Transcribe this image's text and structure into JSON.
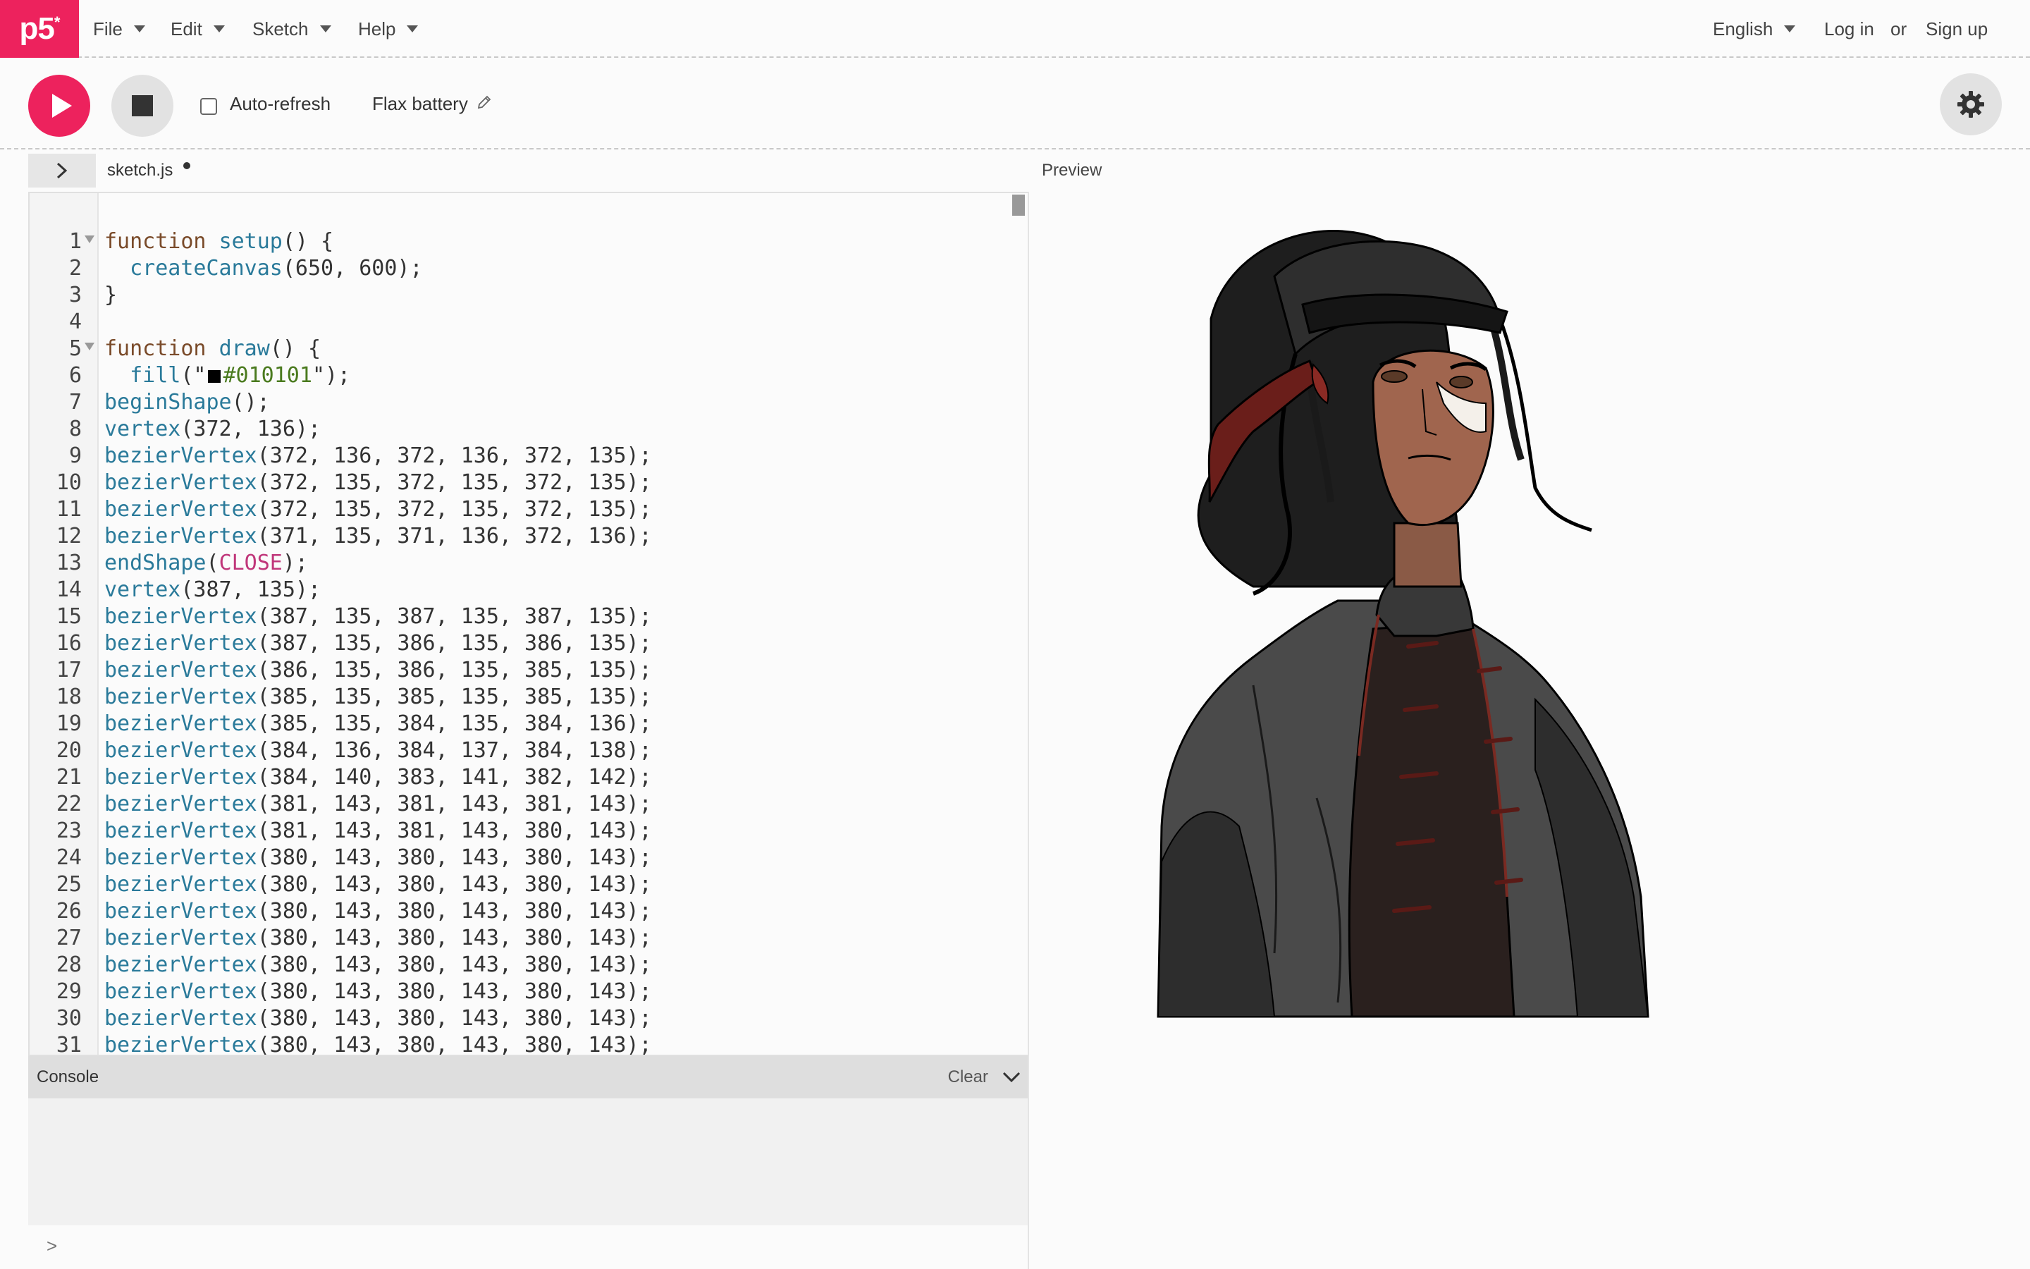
{
  "nav": {
    "logo": "p5",
    "logo_sup": "*",
    "menus": [
      "File",
      "Edit",
      "Sketch",
      "Help"
    ],
    "language": "English",
    "login": "Log in",
    "or": "or",
    "signup": "Sign up"
  },
  "toolbar": {
    "auto_refresh_label": "Auto-refresh",
    "auto_refresh_checked": false,
    "project_name": "Flax battery"
  },
  "editor": {
    "filename": "sketch.js",
    "unsaved": true,
    "lines": [
      "function setup() {",
      "  createCanvas(650, 600);",
      "}",
      "",
      "function draw() {",
      "  fill(\"#010101\");",
      "beginShape();",
      "vertex(372, 136);",
      "bezierVertex(372, 136, 372, 136, 372, 135);",
      "bezierVertex(372, 135, 372, 135, 372, 135);",
      "bezierVertex(372, 135, 372, 135, 372, 135);",
      "bezierVertex(371, 135, 371, 136, 372, 136);",
      "endShape(CLOSE);",
      "vertex(387, 135);",
      "bezierVertex(387, 135, 387, 135, 387, 135);",
      "bezierVertex(387, 135, 386, 135, 386, 135);",
      "bezierVertex(386, 135, 386, 135, 385, 135);",
      "bezierVertex(385, 135, 385, 135, 385, 135);",
      "bezierVertex(385, 135, 384, 135, 384, 136);",
      "bezierVertex(384, 136, 384, 137, 384, 138);",
      "bezierVertex(384, 140, 383, 141, 382, 142);",
      "bezierVertex(381, 143, 381, 143, 381, 143);",
      "bezierVertex(381, 143, 381, 143, 380, 143);",
      "bezierVertex(380, 143, 380, 143, 380, 143);",
      "bezierVertex(380, 143, 380, 143, 380, 143);",
      "bezierVertex(380, 143, 380, 143, 380, 143);",
      "bezierVertex(380, 143, 380, 143, 380, 143);",
      "bezierVertex(380, 143, 380, 143, 380, 143);",
      "bezierVertex(380, 143, 380, 143, 380, 143);",
      "bezierVertex(380, 143, 380, 143, 380, 143);",
      "bezierVertex(380, 143, 380, 143, 380, 143);"
    ],
    "fold_lines": [
      1,
      5
    ]
  },
  "preview": {
    "label": "Preview"
  },
  "console": {
    "title": "Console",
    "clear_label": "Clear",
    "prompt": ">"
  },
  "colors": {
    "accent": "#ed225d",
    "keyword": "#7a4b2a",
    "function": "#2a7a9a",
    "string": "#4a7a1e",
    "constant": "#c0367a",
    "swatch": "#010101"
  },
  "icons": {
    "play": "play-icon",
    "stop": "stop-icon",
    "settings": "gear-icon",
    "sidebar_toggle": "chevron-right-icon",
    "edit": "pencil-icon",
    "console_collapse": "chevron-down-icon"
  }
}
